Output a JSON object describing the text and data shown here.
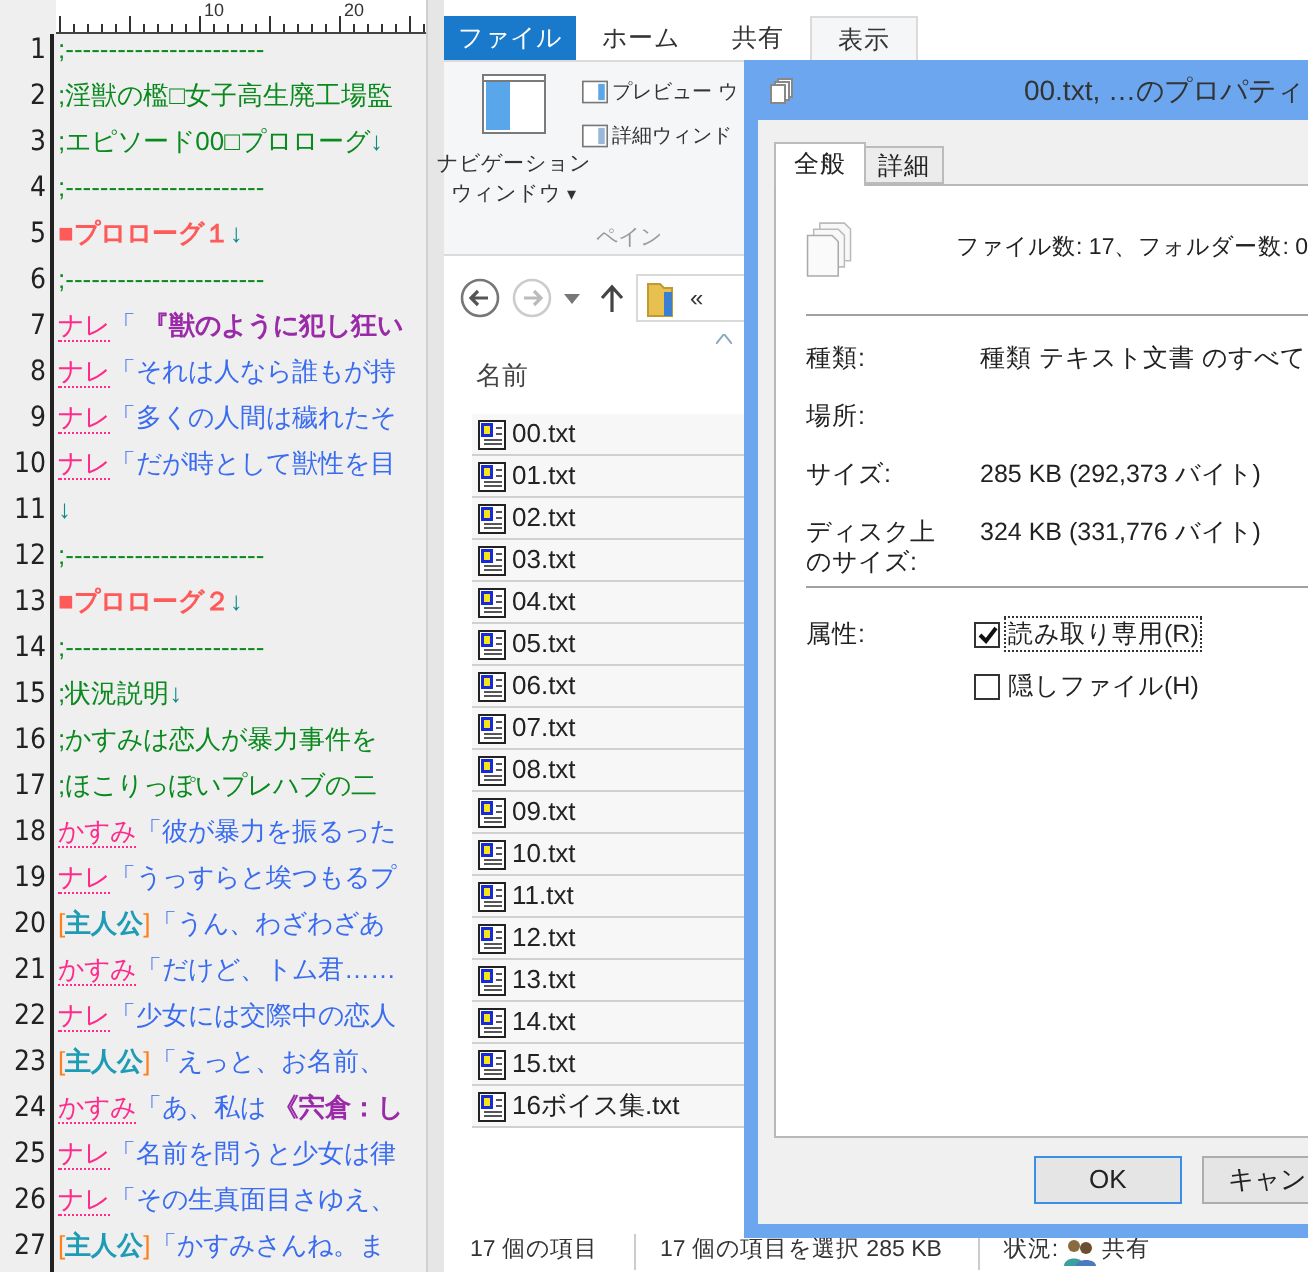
{
  "editor": {
    "ruler_labels": [
      "10",
      "20"
    ],
    "lines": [
      {
        "number": "1",
        "kind": "comment",
        "text": ";-----------------------"
      },
      {
        "number": "2",
        "kind": "comment",
        "text": ";淫獣の檻□女子高生廃工場監"
      },
      {
        "number": "3",
        "kind": "comment",
        "text": ";エピソード00□プロローグ",
        "eol": "↓"
      },
      {
        "number": "4",
        "kind": "comment",
        "text": ";-----------------------"
      },
      {
        "number": "5",
        "kind": "heading",
        "mark": "■",
        "text": "プロローグ１",
        "eol": "↓"
      },
      {
        "number": "6",
        "kind": "comment",
        "text": ";-----------------------"
      },
      {
        "number": "7",
        "kind": "dialogue",
        "speaker": "ナレ",
        "text": "「 **『獣のように犯し狂い**"
      },
      {
        "number": "8",
        "kind": "dialogue",
        "speaker": "ナレ",
        "text": "「それは人なら誰もが持"
      },
      {
        "number": "9",
        "kind": "dialogue",
        "speaker": "ナレ",
        "text": "「多くの人間は穢れたそ"
      },
      {
        "number": "10",
        "kind": "dialogue",
        "speaker": "ナレ",
        "text": "「だが時として獣性を目"
      },
      {
        "number": "11",
        "kind": "blank",
        "eol": "↓"
      },
      {
        "number": "12",
        "kind": "comment",
        "text": ";-----------------------"
      },
      {
        "number": "13",
        "kind": "heading",
        "mark": "■",
        "text": "プロローグ２",
        "eol": "↓"
      },
      {
        "number": "14",
        "kind": "comment",
        "text": ";-----------------------"
      },
      {
        "number": "15",
        "kind": "comment",
        "text": ";状況説明",
        "eol": "↓"
      },
      {
        "number": "16",
        "kind": "comment",
        "text": ";かすみは恋人が暴力事件を"
      },
      {
        "number": "17",
        "kind": "comment",
        "text": ";ほこりっぽいプレハブの二"
      },
      {
        "number": "18",
        "kind": "dialogue",
        "speaker": "かすみ",
        "text": "「彼が暴力を振るった"
      },
      {
        "number": "19",
        "kind": "dialogue",
        "speaker": "ナレ",
        "text": "「うっすらと埃つもるプ"
      },
      {
        "number": "20",
        "kind": "dialogue",
        "speaker": "主人公",
        "bracket_open": "[",
        "bracket_close": "]",
        "text": "「うん、わざわざあ"
      },
      {
        "number": "21",
        "kind": "dialogue",
        "speaker": "かすみ",
        "text": "「だけど、トム君……"
      },
      {
        "number": "22",
        "kind": "dialogue",
        "speaker": "ナレ",
        "text": "「少女には交際中の恋人"
      },
      {
        "number": "23",
        "kind": "dialogue",
        "speaker": "主人公",
        "bracket_open": "[",
        "bracket_close": "]",
        "text": "「えっと、お名前、"
      },
      {
        "number": "24",
        "kind": "dialogue",
        "speaker": "かすみ",
        "text": "「あ、私は **《宍倉：し**"
      },
      {
        "number": "25",
        "kind": "dialogue",
        "speaker": "ナレ",
        "text": "「名前を問うと少女は律"
      },
      {
        "number": "26",
        "kind": "dialogue",
        "speaker": "ナレ",
        "text": "「その生真面目さゆえ、"
      },
      {
        "number": "27",
        "kind": "dialogue",
        "speaker": "主人公",
        "bracket_open": "[",
        "bracket_close": "]",
        "text": "「かすみさんね。ま"
      }
    ]
  },
  "explorer": {
    "ribbon_tabs": [
      {
        "label": "ファイル",
        "kind": "file",
        "selected": false
      },
      {
        "label": "ホーム",
        "kind": "tab",
        "selected": false
      },
      {
        "label": "共有",
        "kind": "tab",
        "selected": false
      },
      {
        "label": "表示",
        "kind": "tab",
        "selected": true
      }
    ],
    "ribbon": {
      "nav_pane": {
        "line1": "ナビゲーション",
        "line2": "ウィンドウ",
        "caret": "▾"
      },
      "items": [
        "プレビュー ウ",
        "詳細ウィンド"
      ],
      "group_label": "ペイン"
    },
    "address": {
      "prefix": "«"
    },
    "column_header": "名前",
    "files": [
      {
        "name": "00.txt",
        "selected": true
      },
      {
        "name": "01.txt",
        "selected": true
      },
      {
        "name": "02.txt",
        "selected": true
      },
      {
        "name": "03.txt",
        "selected": true
      },
      {
        "name": "04.txt",
        "selected": true
      },
      {
        "name": "05.txt",
        "selected": true
      },
      {
        "name": "06.txt",
        "selected": true
      },
      {
        "name": "07.txt",
        "selected": true
      },
      {
        "name": "08.txt",
        "selected": true
      },
      {
        "name": "09.txt",
        "selected": true
      },
      {
        "name": "10.txt",
        "selected": true
      },
      {
        "name": "11.txt",
        "selected": true
      },
      {
        "name": "12.txt",
        "selected": true
      },
      {
        "name": "13.txt",
        "selected": true
      },
      {
        "name": "14.txt",
        "selected": true
      },
      {
        "name": "15.txt",
        "selected": true
      },
      {
        "name": "16ボイス集.txt",
        "selected": true
      }
    ],
    "status_bar": {
      "count": "17 個の項目",
      "selection": "17 個の項目を選択  285 KB",
      "state_label": "状況:",
      "state_value": "共有"
    }
  },
  "dialog": {
    "title": "00.txt, …のプロパティ",
    "tabs": [
      {
        "label": "全般",
        "selected": true
      },
      {
        "label": "詳細",
        "selected": false
      }
    ],
    "summary": "ファイル数: 17、フォルダー数: 0",
    "properties": [
      {
        "label": "種類:",
        "value": "種類 テキスト文書 のすべて"
      },
      {
        "label": "場所:"
      },
      {
        "label": "サイズ:",
        "value": "285 KB (292,373 バイト)"
      },
      {
        "label": "ディスク上のサイズ:",
        "value": "324 KB (331,776 バイト)"
      }
    ],
    "attributes_label": "属性:",
    "attributes": [
      {
        "label": "読み取り専用(R)",
        "checked": true,
        "focused": true
      },
      {
        "label": "隠しファイル(H)",
        "checked": false,
        "focused": false
      }
    ],
    "buttons": [
      {
        "label": "OK",
        "default": true
      },
      {
        "label": "キャン",
        "default": false
      }
    ]
  }
}
